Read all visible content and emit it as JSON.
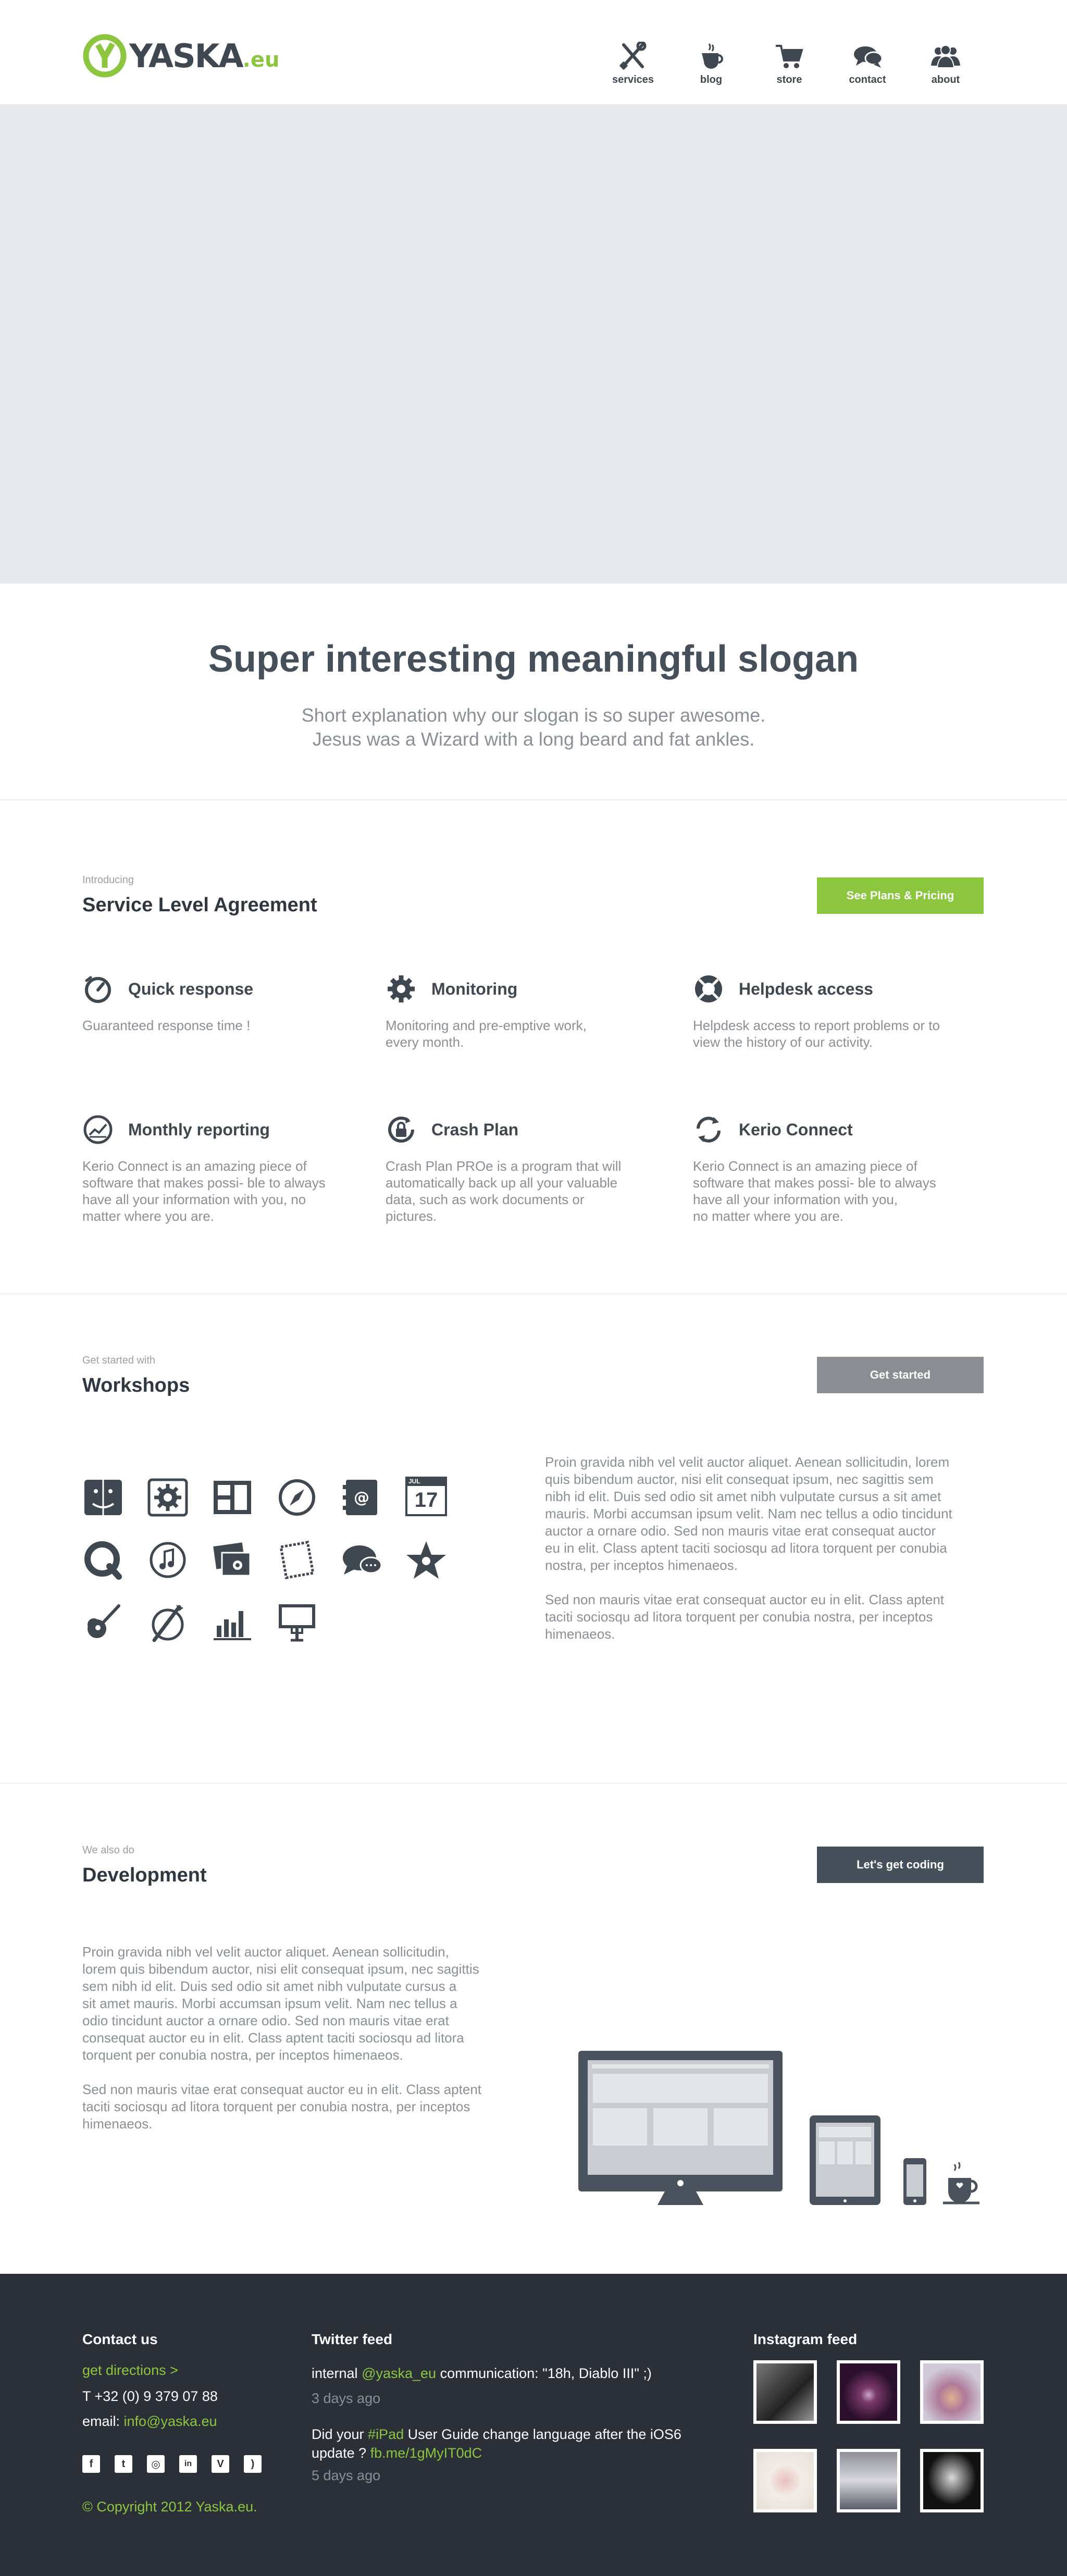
{
  "brand": {
    "name": "YASKA",
    "tld": ".eu",
    "accent": "#8cc63f",
    "dark": "#2b3038",
    "text": "#3f4750"
  },
  "nav": [
    {
      "label": "services",
      "icon": "tools-icon"
    },
    {
      "label": "blog",
      "icon": "coffee-cup-icon"
    },
    {
      "label": "store",
      "icon": "shopping-cart-icon"
    },
    {
      "label": "contact",
      "icon": "speech-bubbles-icon"
    },
    {
      "label": "about",
      "icon": "people-icon"
    }
  ],
  "slogan": {
    "title": "Super interesting meaningful slogan",
    "subtitle": "Short explanation why our slogan is so super awesome.\nJesus was a Wizard with a long beard and fat ankles."
  },
  "sla": {
    "kicker": "Introducing",
    "title": "Service Level Agreement",
    "button": "See Plans & Pricing",
    "button_color": "#8cc63f",
    "features": [
      {
        "title": "Quick response",
        "text": "Guaranteed response time !",
        "icon": "stopwatch-icon"
      },
      {
        "title": "Monitoring",
        "text": "Monitoring and pre-emptive work,\nevery month.",
        "icon": "gear-icon"
      },
      {
        "title": "Helpdesk access",
        "text": "Helpdesk access to report problems or to\nview the history of our activity.",
        "icon": "lifebuoy-icon"
      },
      {
        "title": "Monthly reporting",
        "text": "Kerio Connect is an amazing piece of\nsoftware that makes possi- ble to always\n have all your information with you, no\nmatter where you are.",
        "icon": "report-chart-icon"
      },
      {
        "title": "Crash Plan",
        "text": "Crash Plan PROe is a program that will\nautomatically back up all your valuable\ndata, such as work documents or\npictures.",
        "icon": "lock-refresh-icon"
      },
      {
        "title": "Kerio Connect",
        "text": "Kerio Connect is an amazing piece of\nsoftware that makes possi- ble to always\nhave all your information with you,\nno matter where you are.",
        "icon": "sync-arrows-icon"
      }
    ]
  },
  "workshops": {
    "kicker": "Get started with",
    "title": "Workshops",
    "button": "Get started",
    "button_color": "#8a8e92",
    "icons": [
      "finder-icon",
      "system-preferences-icon",
      "dashboard-icon",
      "safari-compass-icon",
      "address-book-icon",
      "ical-calendar-icon",
      "quicktime-icon",
      "itunes-music-icon",
      "iphoto-icon",
      "preview-stamp-icon",
      "messages-icon",
      "imovie-star-icon",
      "garageband-guitar-icon",
      "xcode-icon",
      "numbers-chart-icon",
      "keynote-podium-icon"
    ],
    "calendar_month": "JUL",
    "calendar_day": "17",
    "text": "Proin gravida nibh vel velit auctor aliquet. Aenean sollicitudin, lorem\nquis bibendum auctor, nisi elit consequat ipsum, nec sagittis sem\nnibh id elit. Duis sed odio sit amet nibh vulputate cursus a sit amet\nmauris. Morbi accumsan ipsum velit. Nam nec tellus a odio tincidunt\nauctor a ornare odio. Sed non  mauris vitae erat consequat auctor\neu in elit. Class aptent taciti sociosqu ad litora torquent per conubia\nnostra, per inceptos himenaeos.\n\n Sed non  mauris vitae erat consequat auctor eu in elit. Class aptent\ntaciti sociosqu ad litora torquent per conubia nostra, per inceptos\nhimenaeos."
  },
  "development": {
    "kicker": "We also do",
    "title": "Development",
    "button": "Let's get coding",
    "button_color": "#46505a",
    "text": "Proin gravida nibh vel velit auctor aliquet. Aenean sollicitudin,\nlorem quis bibendum auctor, nisi elit consequat ipsum, nec sagittis\nsem nibh id elit. Duis sed odio sit amet nibh vulputate cursus a\nsit amet mauris. Morbi accumsan ipsum velit. Nam nec tellus a\nodio tincidunt auctor a ornare odio. Sed non  mauris vitae erat\nconsequat auctor eu in elit. Class aptent taciti sociosqu ad litora\ntorquent per conubia nostra, per inceptos himenaeos.\n\n Sed non  mauris vitae erat consequat auctor eu in elit. Class aptent\ntaciti sociosqu ad litora torquent per conubia nostra, per inceptos\nhimenaeos."
  },
  "footer": {
    "contact": {
      "title": "Contact us",
      "directions": "get directions >",
      "phone": "T +32 (0) 9 379 07 88",
      "email_label": "email: ",
      "email": "info@yaska.eu",
      "copyright": "© Copyright 2012 Yaska.eu.",
      "social": [
        {
          "icon": "facebook-icon",
          "glyph": "f"
        },
        {
          "icon": "twitter-icon",
          "glyph": "t"
        },
        {
          "icon": "instagram-icon",
          "glyph": "◎"
        },
        {
          "icon": "linkedin-icon",
          "glyph": "in"
        },
        {
          "icon": "vimeo-icon",
          "glyph": "V"
        },
        {
          "icon": "rss-icon",
          "glyph": ")"
        }
      ]
    },
    "twitter": {
      "title": "Twitter feed",
      "tweet1_a": "internal ",
      "tweet1_link": "@yaska_eu",
      "tweet1_b": " communication: \"18h, Diablo III\" ;)",
      "tweet1_time": "3 days ago",
      "tweet2_a": "Did your ",
      "tweet2_tag": "#iPad",
      "tweet2_b": " User Guide change language after the iOS6",
      "tweet2_c": "update ? ",
      "tweet2_link": "fb.me/1gMyIT0dC",
      "tweet2_time": "5 days ago"
    },
    "instagram": {
      "title": "Instagram feed"
    }
  }
}
